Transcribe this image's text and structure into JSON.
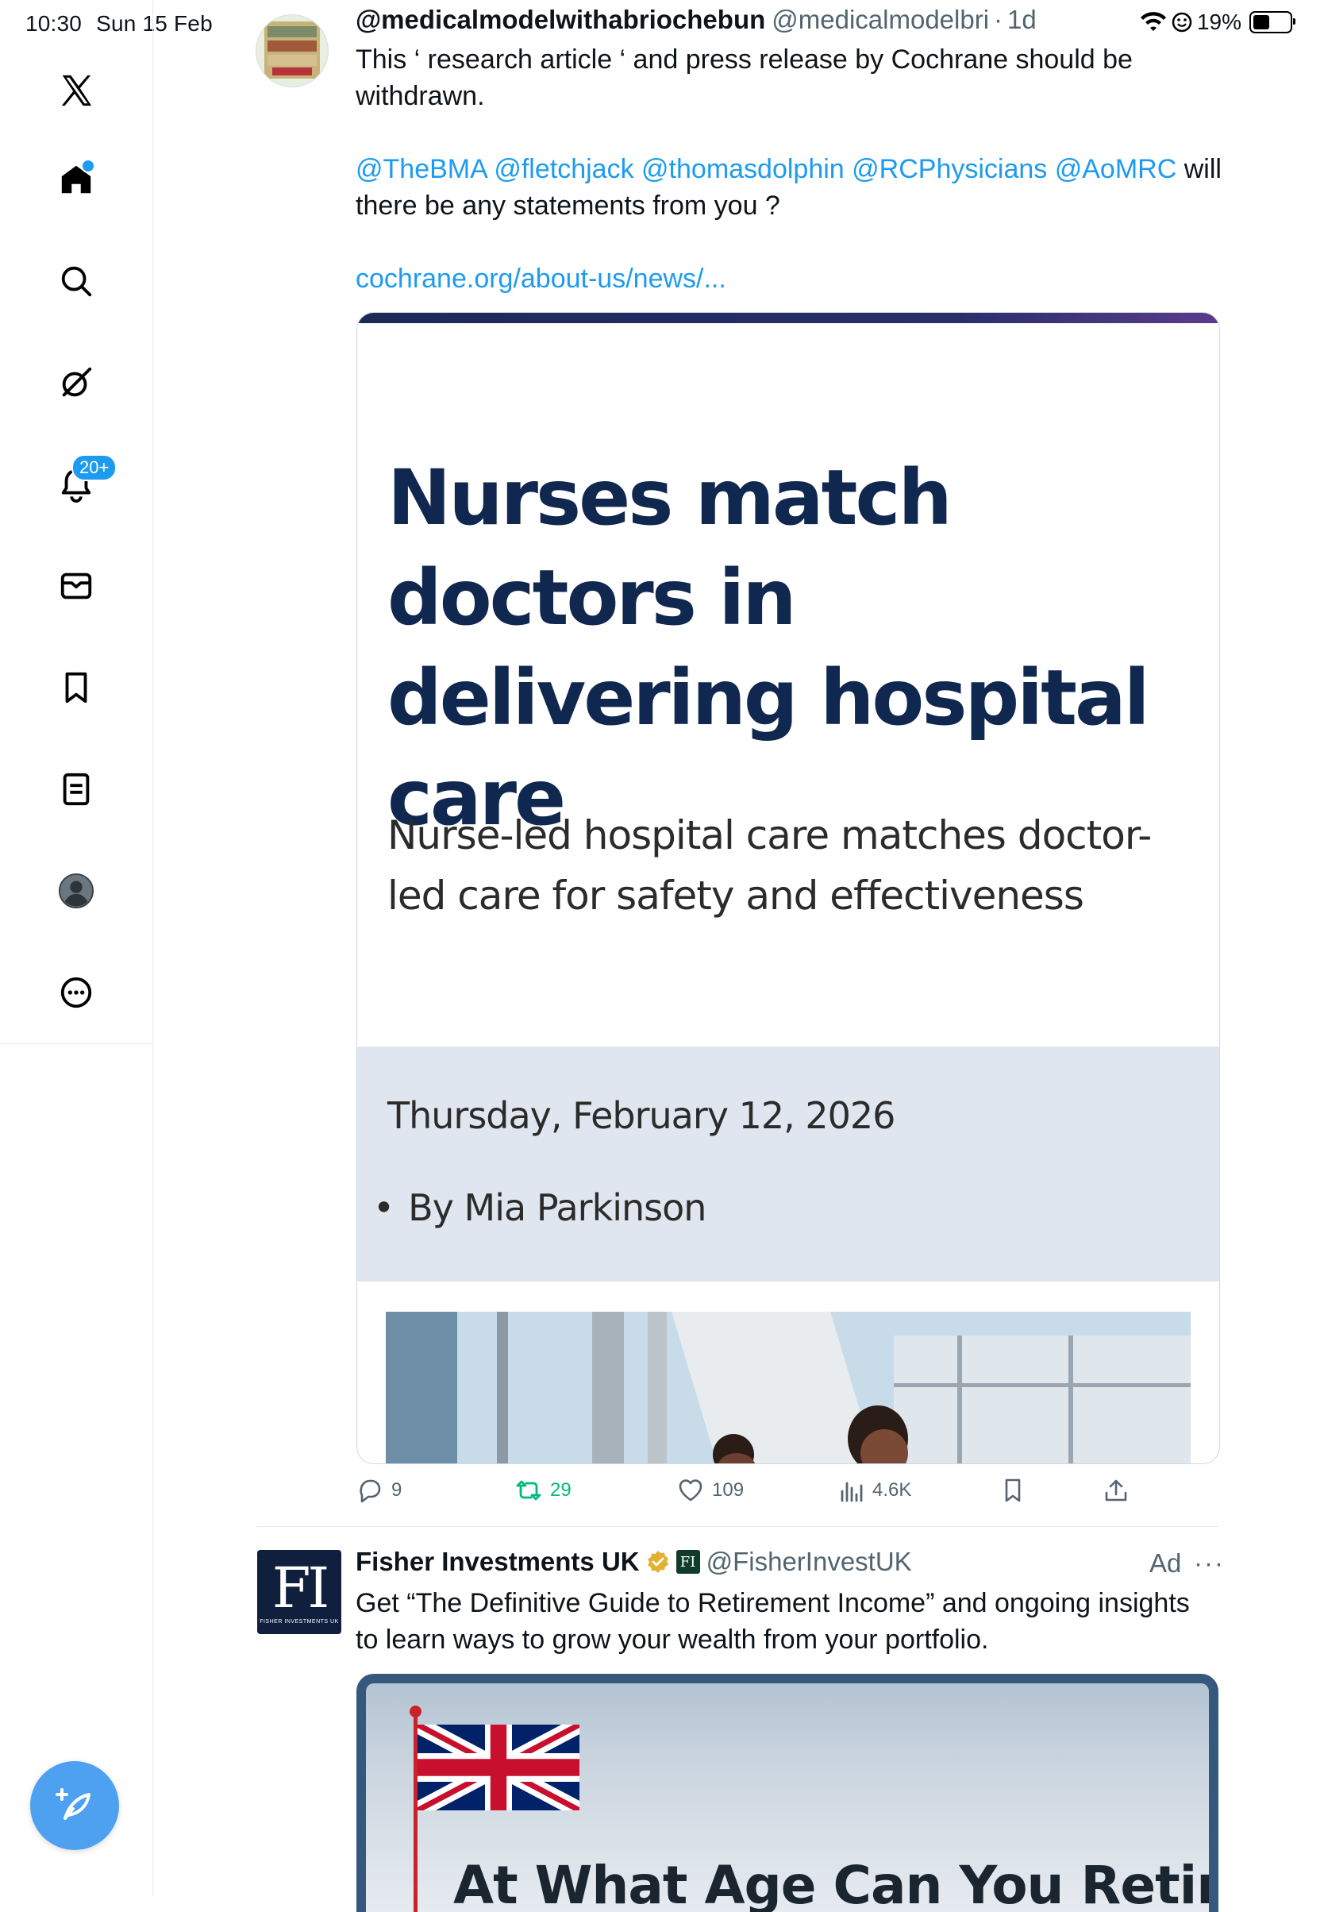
{
  "status_bar": {
    "time": "10:30",
    "date": "Sun 15 Feb",
    "battery": "19%"
  },
  "sidebar": {
    "items": [
      {
        "name": "x-logo"
      },
      {
        "name": "home"
      },
      {
        "name": "search"
      },
      {
        "name": "grok"
      },
      {
        "name": "notifications",
        "badge": "20+"
      },
      {
        "name": "messages"
      },
      {
        "name": "bookmarks"
      },
      {
        "name": "lists"
      },
      {
        "name": "profile"
      },
      {
        "name": "more"
      }
    ]
  },
  "tweet1": {
    "display_name": "@medicalmodelwithabriochebun",
    "handle": "@medicalmodelbri",
    "age": "1d",
    "text_line1": "This ‘ research article ‘ and press release by Cochrane should be",
    "text_line2": "withdrawn.",
    "mentions": "@TheBMA @fletchjack @thomasdolphin @RCPhysicians @AoMRC",
    "mentions_tail": "will",
    "text_line4": "there be any statements from you ?",
    "link": "cochrane.org/about-us/news/...",
    "card": {
      "title": "Nurses match doctors in delivering hospital care",
      "subtitle": "Nurse-led hospital care matches doctor-led care for safety and effectiveness",
      "date": "Thursday, February 12, 2026",
      "author": "By Mia Parkinson"
    },
    "actions": {
      "replies": "9",
      "reposts": "29",
      "likes": "109",
      "views": "4.6K"
    }
  },
  "tweet2": {
    "display_name": "Fisher Investments UK",
    "handle": "@FisherInvestUK",
    "ad_label": "Ad",
    "more": "···",
    "avatar_text": "FI",
    "avatar_subtext": "FISHER INVESTMENTS UK",
    "mini_logo": "FI",
    "text_line1": "Get “The Definitive Guide to Retirement Income” and ongoing insights",
    "text_line2": "to learn ways to grow your wealth from your portfolio.",
    "card_headline": "At What Age Can You Retire"
  },
  "colors": {
    "accent": "#1d9bf0",
    "repost": "#00ba7c",
    "card_title": "#10284f",
    "card_meta_bg": "#e0e6ef"
  }
}
